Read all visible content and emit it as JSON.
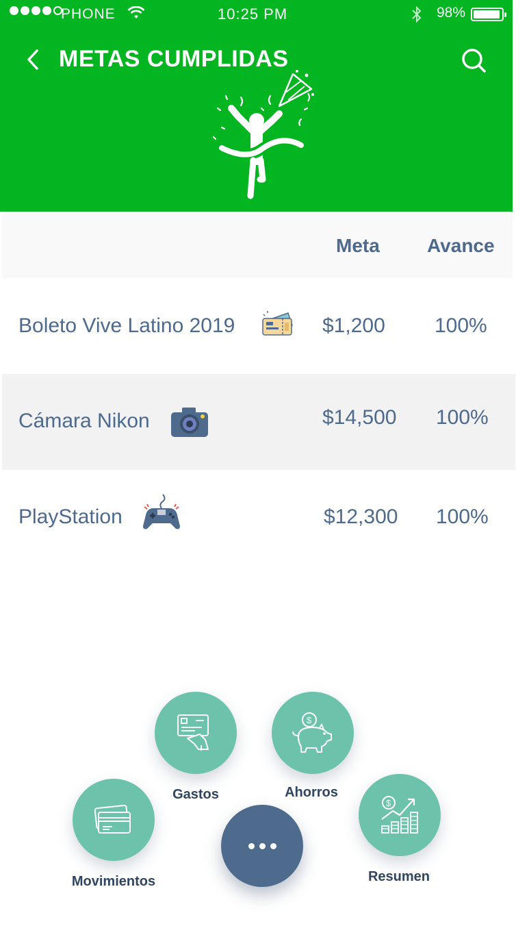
{
  "status_bar": {
    "carrier": "PHONE",
    "time": "10:25 PM",
    "battery": "98%"
  },
  "nav": {
    "title": "METAS CUMPLIDAS",
    "back_icon": "chevron-left-icon",
    "search_icon": "search-icon"
  },
  "table": {
    "headers": {
      "meta": "Meta",
      "avance": "Avance"
    },
    "rows": [
      {
        "name": "Boleto Vive Latino 2019",
        "icon": "ticket-icon",
        "meta": "$1,200",
        "avance": "100%"
      },
      {
        "name": "Cámara Nikon",
        "icon": "camera-icon",
        "meta": "$14,500",
        "avance": "100%"
      },
      {
        "name": "PlayStation",
        "icon": "gamepad-icon",
        "meta": "$12,300",
        "avance": "100%"
      }
    ]
  },
  "menu": {
    "gastos": "Gastos",
    "ahorros": "Ahorros",
    "movimientos": "Movimientos",
    "resumen": "Resumen"
  },
  "colors": {
    "header_green": "#03b520",
    "text_blue": "#4d6a8e",
    "menu_teal": "#6cc2aa",
    "fab_blue": "#4e6a8c"
  }
}
